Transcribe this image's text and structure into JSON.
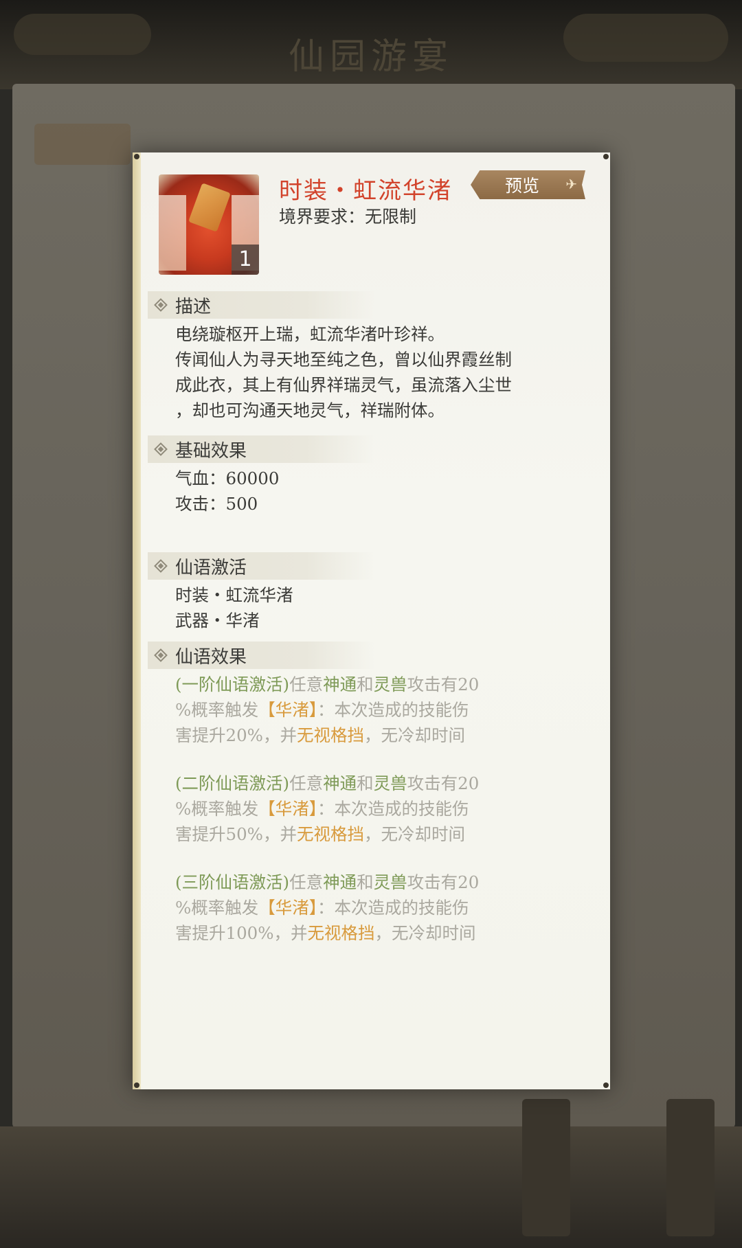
{
  "background": {
    "title": "仙园游宴"
  },
  "item": {
    "title": "时装・虹流华渚",
    "realm_requirement": "境界要求：无限制",
    "count": "1",
    "preview_label": "预览"
  },
  "sections": {
    "description": {
      "heading": "描述",
      "lines": [
        "电绕璇枢开上瑞，虹流华渚叶珍祥。",
        "传闻仙人为寻天地至纯之色，曾以仙界霞丝制",
        "成此衣，其上有仙界祥瑞灵气，虽流落入尘世",
        "，却也可沟通天地灵气，祥瑞附体。"
      ]
    },
    "base_effect": {
      "heading": "基础效果",
      "hp": "气血：60000",
      "attack": "攻击：500"
    },
    "activation": {
      "heading": "仙语激活",
      "items": [
        "时装・虹流华渚",
        "武器・华渚"
      ]
    },
    "effects": {
      "heading": "仙语效果",
      "tiers": [
        {
          "stage": "(一阶仙语激活)",
          "p1": "任意",
          "shentong": "神通",
          "and": "和",
          "lingshou": "灵兽",
          "p2": "攻击有20",
          "l2a": "%概率触发",
          "skill": "【华渚】",
          "l2b": "：本次造成的技能伤",
          "l3a": "害提升20%，并",
          "ignore": "无视格挡",
          "l3b": "，无冷却时间"
        },
        {
          "stage": "(二阶仙语激活)",
          "p1": "任意",
          "shentong": "神通",
          "and": "和",
          "lingshou": "灵兽",
          "p2": "攻击有20",
          "l2a": "%概率触发",
          "skill": "【华渚】",
          "l2b": "：本次造成的技能伤",
          "l3a": "害提升50%，并",
          "ignore": "无视格挡",
          "l3b": "，无冷却时间"
        },
        {
          "stage": "(三阶仙语激活)",
          "p1": "任意",
          "shentong": "神通",
          "and": "和",
          "lingshou": "灵兽",
          "p2": "攻击有20",
          "l2a": "%概率触发",
          "skill": "【华渚】",
          "l2b": "：本次造成的技能伤",
          "l3a": "害提升100%，并",
          "ignore": "无视格挡",
          "l3b": "，无冷却时间"
        }
      ]
    }
  },
  "colors": {
    "title_red": "#d2432b",
    "green": "#7e9a57",
    "orange": "#d89a3c",
    "grey_text": "#aaa89f"
  }
}
